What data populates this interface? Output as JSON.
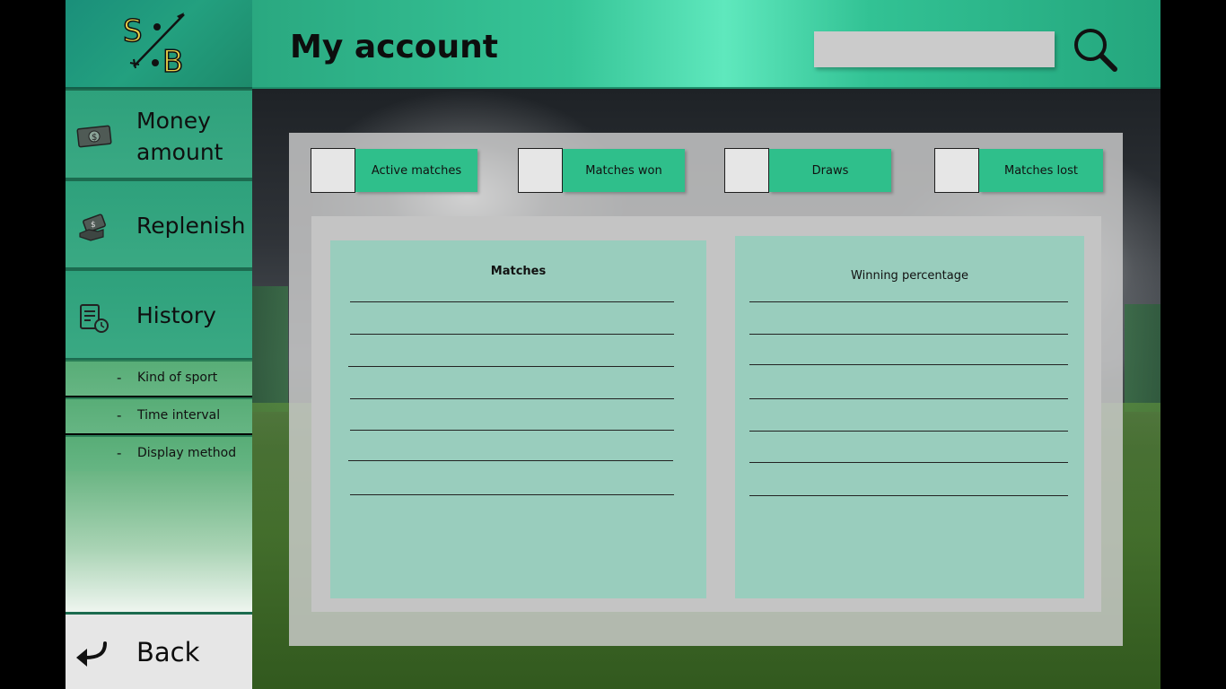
{
  "logo": {
    "letter_left": "S",
    "letter_right": "B"
  },
  "header": {
    "title": "My account",
    "search_placeholder": ""
  },
  "sidebar": {
    "items": [
      {
        "label_line1": "Money",
        "label_line2": "amount",
        "icon": "money-icon"
      },
      {
        "label": "Replenish",
        "icon": "replenish-hand-money-icon"
      },
      {
        "label": "History",
        "icon": "history-document-clock-icon"
      }
    ],
    "sub_items": [
      {
        "dash": "-",
        "label": "Kind of sport"
      },
      {
        "dash": "-",
        "label": "Time interval"
      },
      {
        "dash": "-",
        "label": "Display method"
      }
    ],
    "back_label": "Back"
  },
  "stats": [
    {
      "label": "Active matches"
    },
    {
      "label": "Matches won"
    },
    {
      "label": "Draws"
    },
    {
      "label": "Matches lost"
    }
  ],
  "columns": {
    "left_title": "Matches",
    "right_title": "Winning percentage"
  },
  "colors": {
    "accent": "#2fbf8b",
    "header_green": "#36c597",
    "column_bg": "#99cdbd",
    "panel_bg": "#c4c4c4"
  }
}
